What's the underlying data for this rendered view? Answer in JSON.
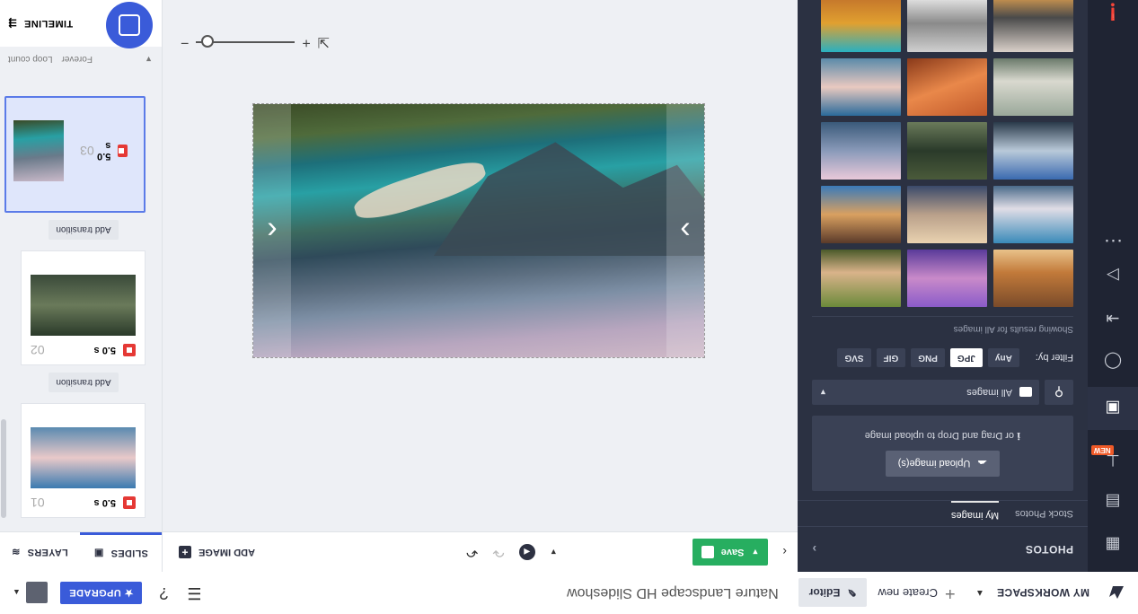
{
  "topbar": {
    "workspace_label": "MY WORKSPACE",
    "create_label": "Create new",
    "editor_label": "Editor",
    "project_title": "Nature Landscape HD Slideshow",
    "upgrade_label": "UPGRADE"
  },
  "rail": {
    "items": [
      "layout-icon",
      "text-icon",
      "transitions-icon",
      "photos-icon",
      "shapes-icon",
      "export-icon",
      "slides-icon",
      "more-icon"
    ],
    "new_badge": "NEW",
    "more_label": "..."
  },
  "panel": {
    "title": "PHOTOS",
    "tabs": [
      "Stock Photos",
      "My images"
    ],
    "upload_button": "Upload image(s)",
    "upload_note": "or Drag and Drop to upload image",
    "select_value": "All images",
    "filter_label": "Filter by:",
    "filters": [
      "Any",
      "JPG",
      "PNG",
      "GIF",
      "SVG"
    ],
    "active_filter": "JPG",
    "showing_text": "Showing results for All images"
  },
  "canvas": {
    "save_label": "Save",
    "add_image_label": "ADD IMAGE",
    "zoom_level": 0.1
  },
  "right": {
    "tabs": [
      "SLIDES",
      "LAYERS"
    ],
    "slides": [
      {
        "num": "01",
        "duration": "5.0 s"
      },
      {
        "num": "02",
        "duration": "5.0 s"
      },
      {
        "num": "03",
        "duration": "5.0 s"
      }
    ],
    "transition_label": "Add transition",
    "loop_label": "Loop count",
    "loop_value": "Forever",
    "timeline_label": "TIMELINE"
  },
  "colors": {
    "accent": "#3a5bd9",
    "save_green": "#27ae60",
    "delete_red": "#e53935",
    "panel_bg": "#2b3142",
    "rail_bg": "#1f2433"
  }
}
